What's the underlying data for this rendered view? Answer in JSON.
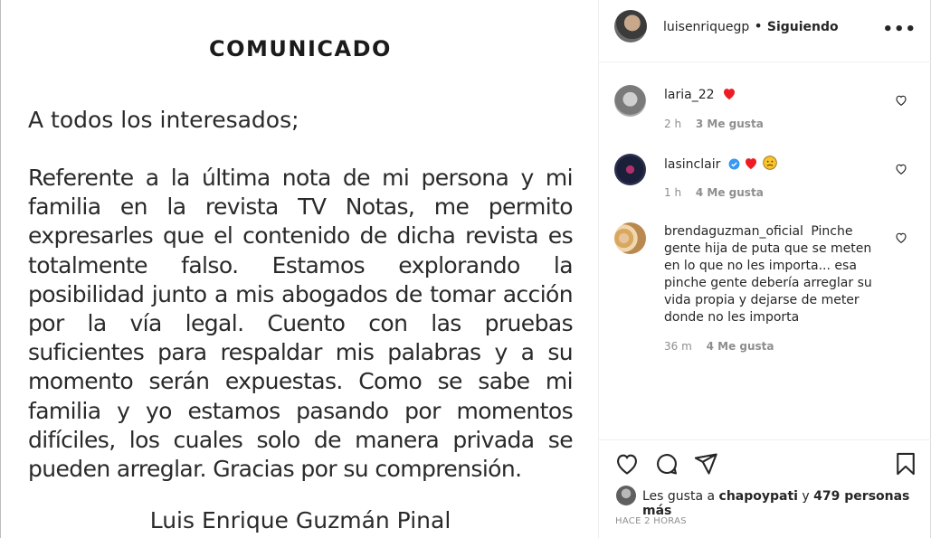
{
  "post": {
    "title": "COMUNICADO",
    "salutation": "A todos los interesados;",
    "body": "Referente a la última nota de mi persona y mi familia en la revista TV Notas, me permito expresarles que el contenido de dicha revista es totalmente falso. Estamos explorando la posibilidad junto a mis abogados de tomar acción por la vía legal. Cuento con las pruebas suficientes para respaldar mis palabras y a su momento serán expuestas. Como se sabe mi familia y yo estamos pasando por momentos difíciles, los cuales solo de manera privada se pueden arreglar. Gracias por su comprensión.",
    "signature": "Luis Enrique Guzmán Pinal"
  },
  "header": {
    "username": "luisenriquegp",
    "separator": "•",
    "follow_state": "Siguiendo",
    "more_icon": "more-horizontal-icon",
    "more_glyph": "•••"
  },
  "comments": [
    {
      "username": "laria_22",
      "text": "",
      "emoji": "❤️",
      "time": "2 h",
      "likes": "3 Me gusta"
    },
    {
      "username": "lasinclair",
      "verified": true,
      "text": "",
      "emoji": "❤️😞",
      "time": "1 h",
      "likes": "4 Me gusta"
    },
    {
      "username": "brendaguzman_oficial",
      "text": "Pinche gente hija de puta que se meten en lo que no les importa... esa pinche gente debería arreglar su vida propia y dejarse de meter donde no les importa",
      "time": "36 m",
      "likes": "4 Me gusta"
    }
  ],
  "actions": {
    "icons": [
      "heart-icon",
      "comment-icon",
      "share-icon",
      "bookmark-icon"
    ]
  },
  "likes_summary": {
    "prefix": "Les gusta a",
    "user": "chapoypati",
    "conjunction": "y",
    "others": "479 personas más"
  },
  "timestamp": "HACE 2 HORAS",
  "colors": {
    "heart_red": "#ed4956",
    "verified_blue": "#3897f0",
    "meta_gray": "#8e8e8e"
  }
}
